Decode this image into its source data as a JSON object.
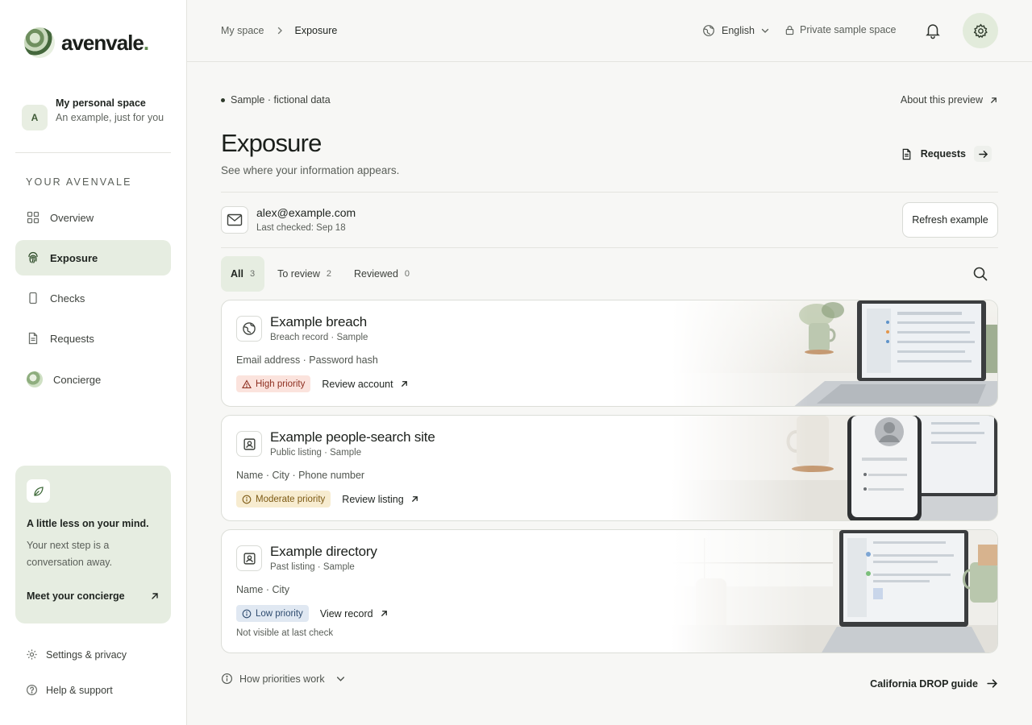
{
  "brand": {
    "name": "avenvale",
    "dot": "."
  },
  "space": {
    "avatar": "A",
    "name": "My personal space",
    "desc": "An example, just for you"
  },
  "sidebar": {
    "section_label": "YOUR AVENVALE",
    "items": [
      {
        "label": "Overview",
        "icon": "grid-icon"
      },
      {
        "label": "Exposure",
        "icon": "fingerprint-icon",
        "active": true
      },
      {
        "label": "Checks",
        "icon": "phone-icon"
      },
      {
        "label": "Requests",
        "icon": "document-icon"
      },
      {
        "label": "Concierge",
        "icon": "concierge-avatar"
      }
    ],
    "promo": {
      "title": "A little less on your mind.",
      "text": "Your next step is a conversation away.",
      "link": "Meet your concierge"
    },
    "footer": [
      {
        "label": "Settings & privacy",
        "icon": "gear-icon"
      },
      {
        "label": "Help & support",
        "icon": "help-icon"
      }
    ]
  },
  "topbar": {
    "breadcrumbs": [
      "My space",
      "Exposure"
    ],
    "language": "English",
    "private_label": "Private sample space"
  },
  "main": {
    "sample_tag": "Sample · fictional data",
    "about_link": "About this preview",
    "title": "Exposure",
    "subtitle": "See where your information appears.",
    "requests_label": "Requests",
    "email": "alex@example.com",
    "last_checked": "Last checked: Sep 18",
    "refresh_label": "Refresh example",
    "tabs": [
      {
        "label": "All",
        "count": "3",
        "active": true
      },
      {
        "label": "To review",
        "count": "2"
      },
      {
        "label": "Reviewed",
        "count": "0"
      }
    ],
    "cards": [
      {
        "title": "Example breach",
        "meta": "Breach record · Sample",
        "fields": "Email address · Password hash",
        "priority": "High priority",
        "priority_level": "high",
        "action": "Review account",
        "note": ""
      },
      {
        "title": "Example people-search site",
        "meta": "Public listing · Sample",
        "fields": "Name · City · Phone number",
        "priority": "Moderate priority",
        "priority_level": "moderate",
        "action": "Review listing",
        "note": ""
      },
      {
        "title": "Example directory",
        "meta": "Past listing · Sample",
        "fields": "Name · City",
        "priority": "Low priority",
        "priority_level": "low",
        "action": "View record",
        "note": "Not visible at last check"
      }
    ],
    "how_priorities": "How priorities work",
    "guide_link": "California DROP guide"
  },
  "colors": {
    "accent_bg": "#e6ede1",
    "high": "#8e2f20",
    "moderate": "#7d5a14",
    "low": "#2f4c6f"
  }
}
